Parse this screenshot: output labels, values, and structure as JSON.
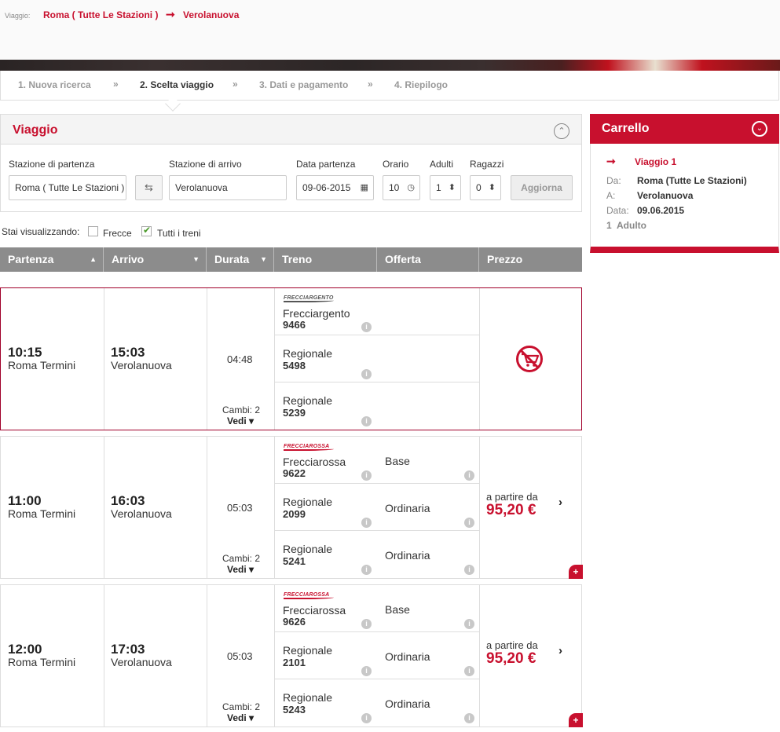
{
  "header": {
    "trip_label": "Viaggio:",
    "from": "Roma ( Tutte Le Stazioni )",
    "arrow": "➞",
    "to": "Verolanuova"
  },
  "steps": [
    {
      "label": "1. Nuova ricerca"
    },
    {
      "label": "2. Scelta viaggio"
    },
    {
      "label": "3. Dati e pagamento"
    },
    {
      "label": "4. Riepilogo"
    }
  ],
  "step_separator": "»",
  "search": {
    "title": "Viaggio",
    "collapse_glyph": "⌃",
    "departure_label": "Stazione di partenza",
    "departure_value": "Roma ( Tutte Le Stazioni )",
    "swap_glyph": "⇆",
    "arrival_label": "Stazione di arrivo",
    "arrival_value": "Verolanuova",
    "date_label": "Data partenza",
    "date_value": "09-06-2015",
    "date_icon": "▦",
    "time_label": "Orario",
    "time_value": "10",
    "time_icon": "◷",
    "adults_label": "Adulti",
    "adults_value": "1",
    "kids_label": "Ragazzi",
    "kids_value": "0",
    "spinner_glyph": "⬍",
    "update_button": "Aggiorna"
  },
  "filters": {
    "label": "Stai visualizzando:",
    "frecce_label": "Frecce",
    "all_label": "Tutti i treni"
  },
  "table_headers": {
    "partenza": "Partenza",
    "arrivo": "Arrivo",
    "durata": "Durata",
    "treno": "Treno",
    "offerta": "Offerta",
    "prezzo": "Prezzo",
    "sort_up": "▲",
    "sort_down": "▼"
  },
  "info_glyph": "i",
  "vedi_label": "Vedi ▾",
  "price_from_label": "a partire da",
  "chevron_glyph": "›",
  "plus_glyph": "+",
  "solutions": [
    {
      "dep_time": "10:15",
      "dep_station": "Roma Termini",
      "arr_time": "15:03",
      "arr_station": "Verolanuova",
      "duration": "04:48",
      "changes": "Cambi: 2",
      "trains": [
        {
          "logo": "FRECCIARGENTO",
          "name": "Frecciargento",
          "number": "9466"
        },
        {
          "logo": "",
          "name": "Regionale",
          "number": "5498"
        },
        {
          "logo": "",
          "name": "Regionale",
          "number": "5239"
        }
      ],
      "offers": [
        "",
        "",
        ""
      ],
      "price": "",
      "not_buyable": true
    },
    {
      "dep_time": "11:00",
      "dep_station": "Roma Termini",
      "arr_time": "16:03",
      "arr_station": "Verolanuova",
      "duration": "05:03",
      "changes": "Cambi: 2",
      "trains": [
        {
          "logo": "FRECCIAROSSA",
          "name": "Frecciarossa",
          "number": "9622"
        },
        {
          "logo": "",
          "name": "Regionale",
          "number": "2099"
        },
        {
          "logo": "",
          "name": "Regionale",
          "number": "5241"
        }
      ],
      "offers": [
        "Base",
        "Ordinaria",
        "Ordinaria"
      ],
      "price": "95,20 €",
      "not_buyable": false
    },
    {
      "dep_time": "12:00",
      "dep_station": "Roma Termini",
      "arr_time": "17:03",
      "arr_station": "Verolanuova",
      "duration": "05:03",
      "changes": "Cambi: 2",
      "trains": [
        {
          "logo": "FRECCIAROSSA",
          "name": "Frecciarossa",
          "number": "9626"
        },
        {
          "logo": "",
          "name": "Regionale",
          "number": "2101"
        },
        {
          "logo": "",
          "name": "Regionale",
          "number": "5243"
        }
      ],
      "offers": [
        "Base",
        "Ordinaria",
        "Ordinaria"
      ],
      "price": "95,20 €",
      "not_buyable": false
    }
  ],
  "cart": {
    "title": "Carrello",
    "expand_glyph": "⌄",
    "arrow": "➞",
    "trip": "Viaggio 1",
    "from_key": "Da:",
    "from_value": "Roma (Tutte Le Stazioni)",
    "to_key": "A:",
    "to_value": "Verolanuova",
    "date_key": "Data:",
    "date_value": "09.06.2015",
    "pax_count": "1",
    "pax_label": "Adulto"
  },
  "colors": {
    "brand_red": "#c8102e",
    "header_gray": "#8c8c8c"
  }
}
